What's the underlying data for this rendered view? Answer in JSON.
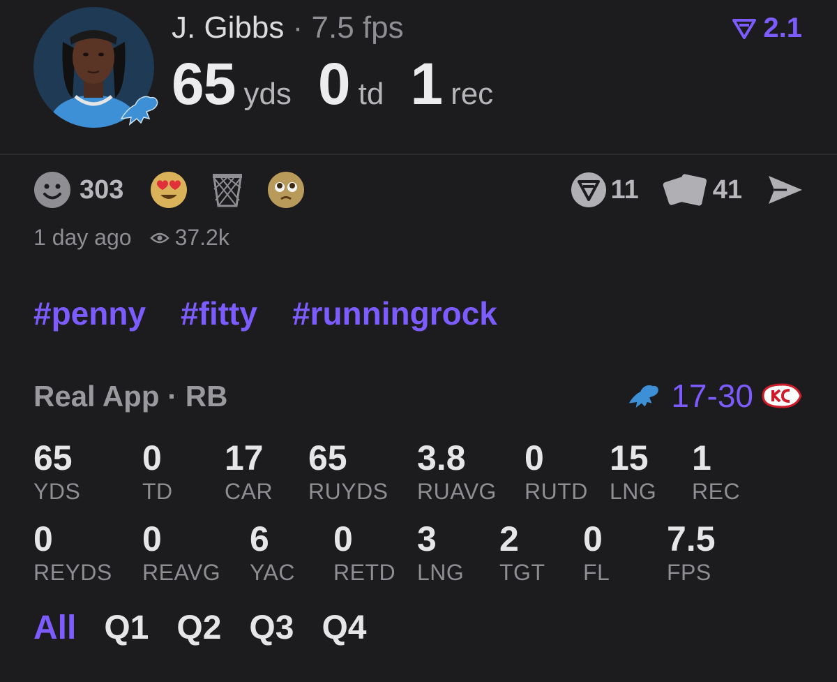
{
  "header": {
    "player_name": "J. Gibbs",
    "separator": "·",
    "fps_text": "7.5 fps",
    "avatar_icon": "player-avatar-photo",
    "team_badge_icon": "detroit-lions-logo",
    "big_stats": [
      {
        "value": "65",
        "unit": "yds"
      },
      {
        "value": "0",
        "unit": "td"
      },
      {
        "value": "1",
        "unit": "rec"
      }
    ],
    "score_badge": {
      "icon": "real-logo-icon",
      "value": "2.1"
    }
  },
  "reactions": {
    "smiley_count": "303",
    "emojis": [
      "heart-eyes-emoji",
      "basketball-hoop-emoji",
      "pleading-face-emoji"
    ]
  },
  "actions": {
    "real_count": "11",
    "cards_count": "41"
  },
  "meta": {
    "time_ago": "1 day ago",
    "views": "37.2k"
  },
  "hashtags": [
    "#penny",
    "#fitty",
    "#runningrock"
  ],
  "game": {
    "source": "Real App · RB",
    "score": "17-30",
    "home_team_icon": "detroit-lions-logo",
    "away_team_icon": "kansas-city-chiefs-logo"
  },
  "stats_row1": [
    {
      "value": "65",
      "label": "YDS"
    },
    {
      "value": "0",
      "label": "TD"
    },
    {
      "value": "17",
      "label": "CAR"
    },
    {
      "value": "65",
      "label": "RUYDS"
    },
    {
      "value": "3.8",
      "label": "RUAVG"
    },
    {
      "value": "0",
      "label": "RUTD"
    },
    {
      "value": "15",
      "label": "LNG"
    },
    {
      "value": "1",
      "label": "REC"
    }
  ],
  "stats_row2": [
    {
      "value": "0",
      "label": "REYDS"
    },
    {
      "value": "0",
      "label": "REAVG"
    },
    {
      "value": "6",
      "label": "YAC"
    },
    {
      "value": "0",
      "label": "RETD"
    },
    {
      "value": "3",
      "label": "LNG"
    },
    {
      "value": "2",
      "label": "TGT"
    },
    {
      "value": "0",
      "label": "FL"
    },
    {
      "value": "7.5",
      "label": "FPS"
    }
  ],
  "tabs": [
    "All",
    "Q1",
    "Q2",
    "Q3",
    "Q4"
  ],
  "colors": {
    "accent": "#7c5cff",
    "background": "#1c1c1e",
    "muted": "#8e8e93"
  }
}
